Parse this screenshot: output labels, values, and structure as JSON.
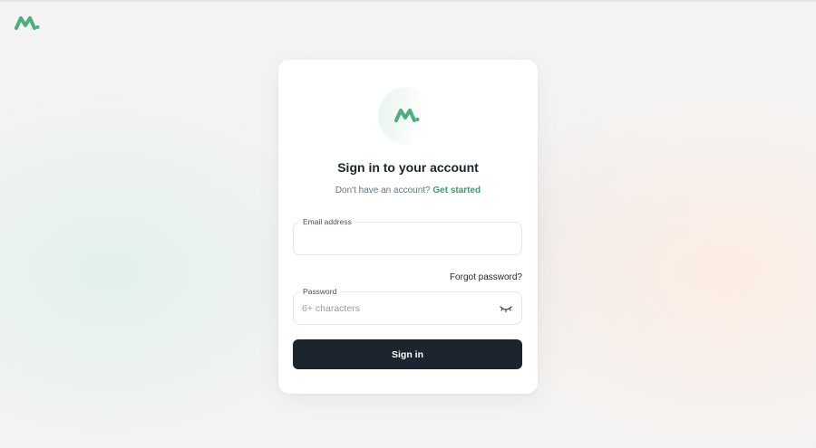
{
  "brand": {
    "logo_icon": "mountain-logo-icon",
    "primary_color": "#3d9a6e",
    "accent_color": "#7fd0a4"
  },
  "card": {
    "title": "Sign in to your account",
    "signup_prompt": "Don't have an account?",
    "signup_link": "Get started",
    "email": {
      "label": "Email address",
      "value": "",
      "placeholder": ""
    },
    "forgot_password": "Forgot password?",
    "password": {
      "label": "Password",
      "value": "",
      "placeholder": "6+ characters",
      "toggle_icon": "eye-closed-icon"
    },
    "submit_label": "Sign in",
    "button_color": "#1c252e"
  }
}
